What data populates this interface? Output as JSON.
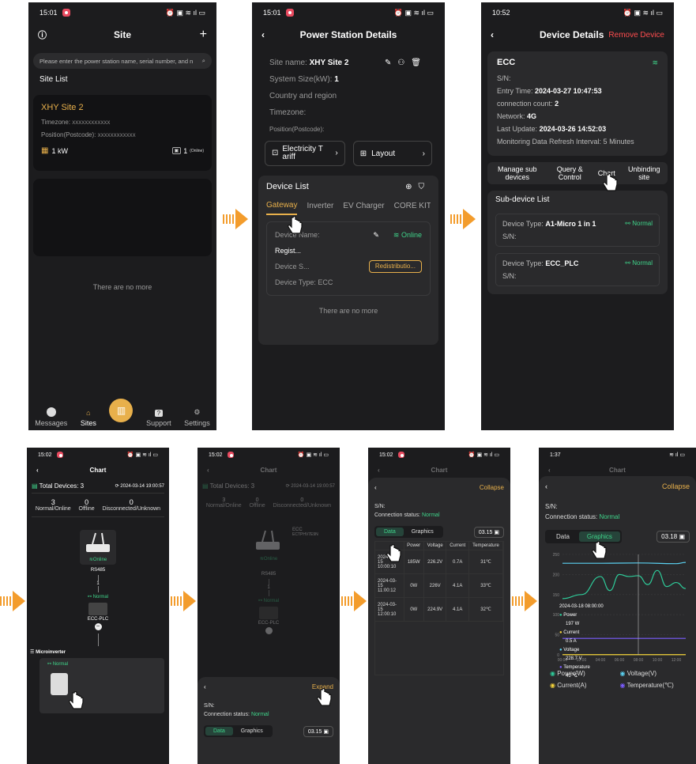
{
  "arrows_color": "#f39c2c",
  "p1": {
    "time": "15:01",
    "title": "Site",
    "search_placeholder": "Please enter the power station name, serial number, and n",
    "list_title": "Site List",
    "site_name": "XHY Site 2",
    "timezone_label": "Timezone:",
    "timezone_value": "XXXXXXXXXXXX",
    "position_label": "Position(Postcode):",
    "position_value": "XXXXXXXXXXXX",
    "power": "1 kW",
    "online_count": "1",
    "online_label": "(Online)",
    "empty": "There are no more",
    "tabs": [
      "Messages",
      "Sites",
      "Support",
      "Settings"
    ]
  },
  "p2": {
    "time": "15:01",
    "title": "Power Station Details",
    "site_name_label": "Site name:",
    "site_name": "XHY Site 2",
    "size_label": "System Size(kW):",
    "size_value": "1",
    "country": "Country and region",
    "timezone": "Timezone:",
    "position": "Position(Postcode):",
    "btn_tariff": "Electricity T ariff",
    "btn_layout": "Layout",
    "device_list": "Device List",
    "tabs": [
      "Gateway",
      "Inverter",
      "EV Charger",
      "CORE KIT"
    ],
    "device_name": "Device Name:",
    "online": "Online",
    "regist": "Regist...",
    "device_s": "Device S...",
    "redistrib": "Redistributio...",
    "device_type": "Device Type: ECC",
    "empty": "There are no more"
  },
  "p3": {
    "time": "10:52",
    "title": "Device Details",
    "remove": "Remove Device",
    "device": "ECC",
    "sn": "S/N:",
    "entry_label": "Entry Time:",
    "entry": "2024-03-27 10:47:53",
    "count_label": "connection count:",
    "count": "2",
    "network_label": "Network:",
    "network": "4G",
    "update_label": "Last Update:",
    "update": "2024-03-26 14:52:03",
    "refresh": "Monitoring Data Refresh Interval: 5 Minutes",
    "actions": [
      "Manage sub devices",
      "Query & Control",
      "Chart",
      "Unbinding site"
    ],
    "sub_title": "Sub-device List",
    "sub1_label": "Device Type:",
    "sub1": "A1-Micro 1 in 1",
    "sub2": "ECC_PLC",
    "normal": "Normal",
    "sn2": "S/N:"
  },
  "p4": {
    "time": "15:02",
    "title": "Chart",
    "total_label": "Total Devices:",
    "total": "3",
    "timestamp": "2024-03-14 19:00:57",
    "stats": [
      {
        "v": "3",
        "l": "Normal/Online"
      },
      {
        "v": "0",
        "l": "Offline"
      },
      {
        "v": "0",
        "l": "Disconnected/Unknown"
      }
    ],
    "gateway_status": "Online",
    "rs485": "RS485",
    "one": "1",
    "normal": "Normal",
    "plc": "ECC-PLC",
    "micro": "Microinverter",
    "micro_status": "Normal"
  },
  "p5": {
    "time": "15:02",
    "title": "Chart",
    "total_label": "Total Devices:",
    "total": "3",
    "timestamp": "2024-03-14 19:00:57",
    "stats": [
      {
        "v": "3",
        "l": "Normal/Online"
      },
      {
        "v": "0",
        "l": "Offline"
      },
      {
        "v": "0",
        "l": "Disconnected/Unknown"
      }
    ],
    "ecc": "ECC",
    "ecc_sn": "ECTPHV7E9N",
    "online": "Online",
    "rs485": "RS485",
    "one": "1",
    "normal": "Normal",
    "plc": "ECC-PLC",
    "expand": "Expand",
    "sn": "S/N:",
    "conn_label": "Connection status:",
    "conn": "Normal",
    "tab_data": "Data",
    "tab_graphics": "Graphics",
    "date": "03.15"
  },
  "p6": {
    "time": "15:02",
    "title": "Chart",
    "collapse": "Collapse",
    "sn": "S/N:",
    "conn_label": "Connection status:",
    "conn": "Normal",
    "tab_data": "Data",
    "tab_graphics": "Graphics",
    "date": "03.15",
    "headers": [
      "",
      "Power",
      "Voltage",
      "Current",
      "Temperature"
    ],
    "rows": [
      [
        "2024-03-15 10:00:10",
        "185W",
        "226.2V",
        "0.7A",
        "31℃"
      ],
      [
        "2024-03-15 11:00:12",
        "0W",
        "226V",
        "4.1A",
        "33℃"
      ],
      [
        "2024-03-15 12:00:10",
        "0W",
        "224.9V",
        "4.1A",
        "32℃"
      ]
    ]
  },
  "p7": {
    "time": "1:37",
    "title": "Chart",
    "collapse": "Collapse",
    "sn": "S/N:",
    "conn_label": "Connection status:",
    "conn": "Normal",
    "tab_data": "Data",
    "tab_graphics": "Graphics",
    "date": "03.18",
    "tooltip_time": "2024-03-18 08:00:00",
    "tooltip": [
      {
        "name": "Power",
        "value": "197 W"
      },
      {
        "name": "Current",
        "value": "0.5 A"
      },
      {
        "name": "Voltage",
        "value": "228.7 V"
      },
      {
        "name": "Temperature",
        "value": "41 ℃"
      }
    ],
    "legend": [
      "Power(W)",
      "Voltage(V)",
      "Current(A)",
      "Temperature(℃)"
    ]
  },
  "chart_data": {
    "type": "line",
    "title": "",
    "xlabel": "",
    "ylabel": "",
    "x": [
      "00:00",
      "02:00",
      "04:00",
      "06:00",
      "08:00",
      "10:00",
      "12:00"
    ],
    "ylim": [
      0,
      250
    ],
    "yticks": [
      0,
      50,
      100,
      150,
      200,
      250
    ],
    "colors": {
      "Power": "#2ecc9a",
      "Voltage": "#5ad0f0",
      "Current": "#f5d43a",
      "Temperature": "#7b5cff"
    },
    "series": [
      {
        "name": "Power(W)",
        "x": [
          "00:00",
          "02:00",
          "04:00",
          "05:00",
          "06:00",
          "07:00",
          "08:00",
          "09:00",
          "10:00",
          "11:00",
          "12:00",
          "13:00"
        ],
        "values": [
          140,
          150,
          195,
          160,
          200,
          195,
          197,
          175,
          210,
          170,
          180,
          165
        ]
      },
      {
        "name": "Voltage(V)",
        "x": [
          "00:00",
          "04:00",
          "08:00",
          "12:00",
          "13:00"
        ],
        "values": [
          228,
          228,
          228.7,
          227,
          230
        ]
      },
      {
        "name": "Current(A)",
        "x": [
          "00:00",
          "13:00"
        ],
        "values": [
          0.5,
          0.5
        ]
      },
      {
        "name": "Temperature(℃)",
        "x": [
          "00:00",
          "13:00"
        ],
        "values": [
          41,
          41
        ]
      }
    ]
  }
}
